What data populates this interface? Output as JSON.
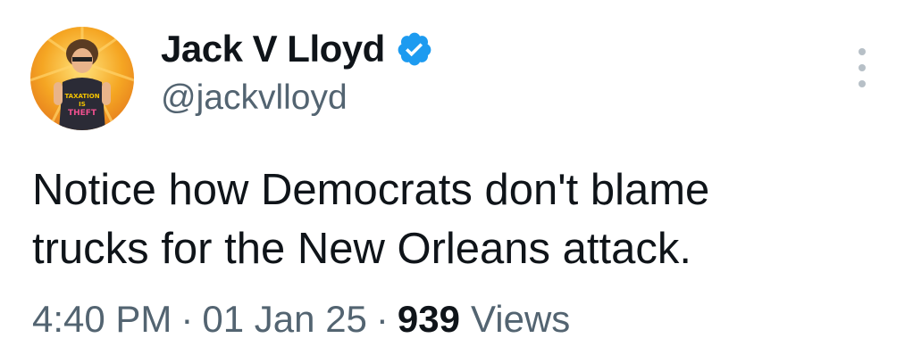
{
  "author": {
    "display_name": "Jack V Lloyd",
    "handle": "@jackvlloyd",
    "verified": true,
    "verified_color": "#1d9bf0",
    "avatar_shirt_text": [
      "TAXATION",
      "IS",
      "THEFT"
    ]
  },
  "tweet": {
    "text": "Notice how Democrats don't blame\ntrucks for the New Orleans attack.",
    "time": "4:40 PM",
    "separator": "·",
    "date": "01 Jan 25",
    "views_count": "939",
    "views_label": "Views"
  },
  "icons": {
    "more": "more-dots-vertical-icon",
    "verified": "verified-badge-icon"
  }
}
